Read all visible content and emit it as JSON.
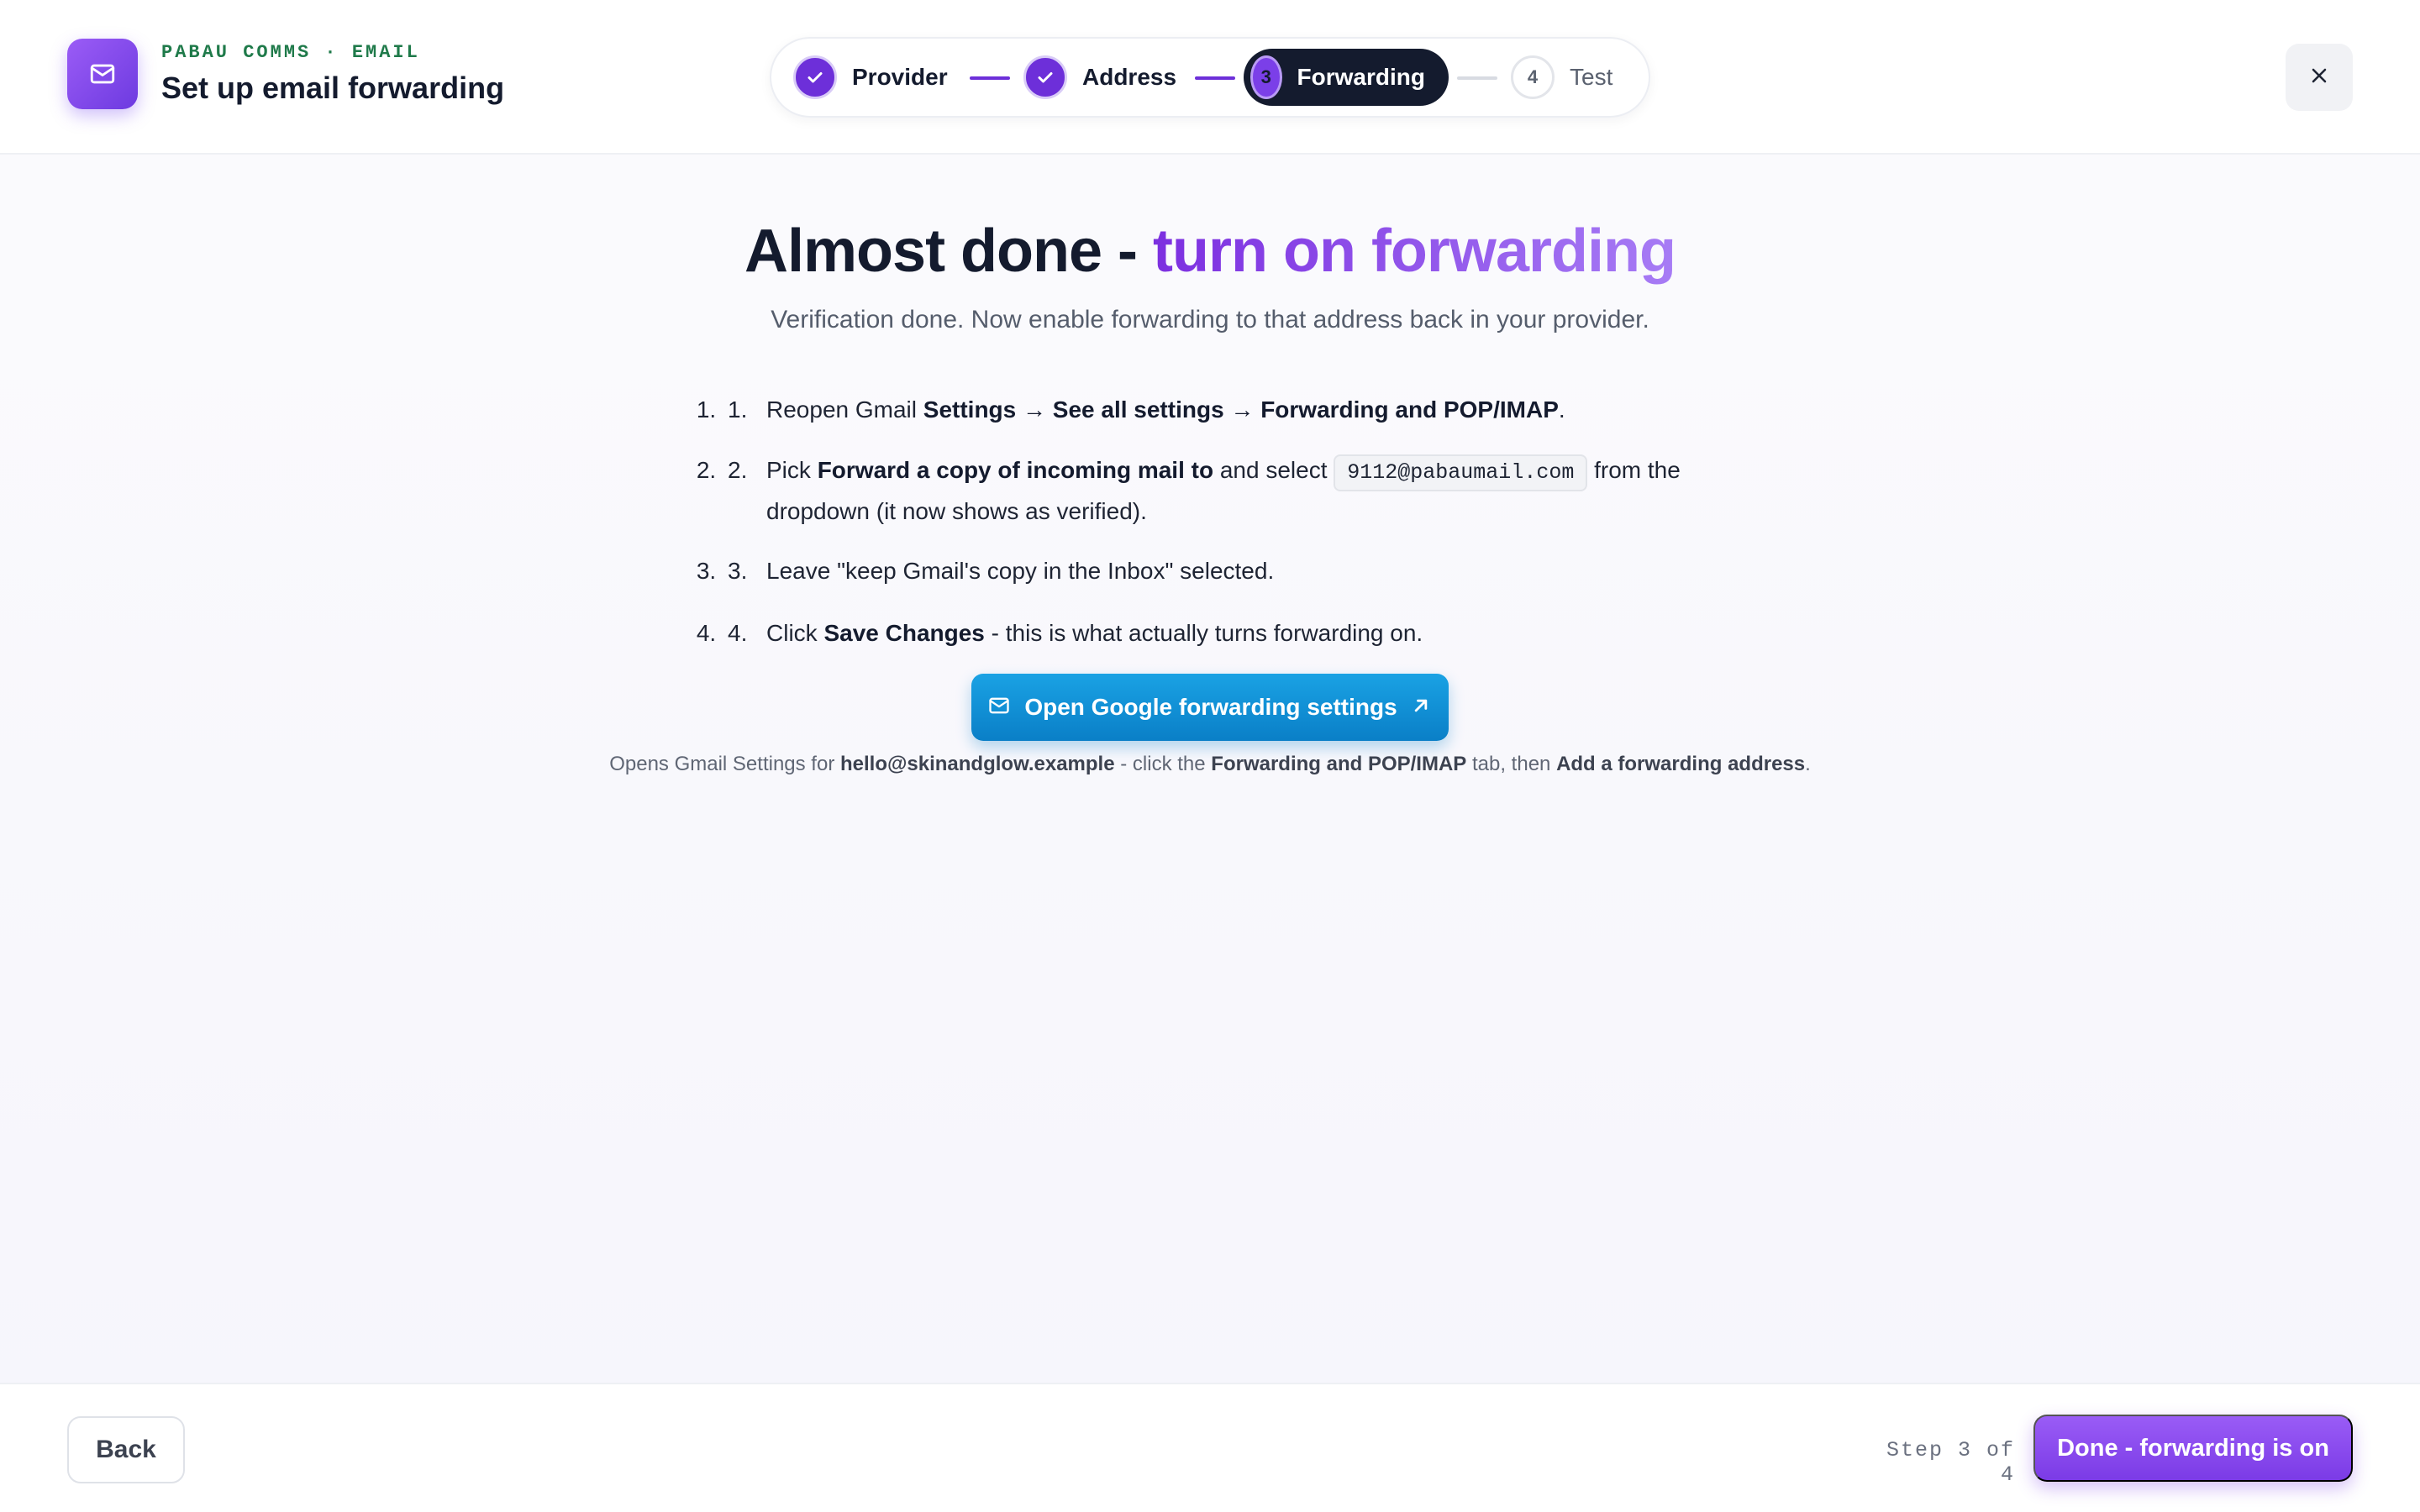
{
  "header": {
    "brand_icon": "mail-icon",
    "eyebrow": "PABAU COMMS · EMAIL",
    "title": "Set up email forwarding",
    "close_icon": "close-icon"
  },
  "stepper": {
    "steps": [
      {
        "number": "1",
        "label": "Provider",
        "status": "done"
      },
      {
        "number": "2",
        "label": "Address",
        "status": "done"
      },
      {
        "number": "3",
        "label": "Forwarding",
        "status": "active"
      },
      {
        "number": "4",
        "label": "Test",
        "status": "todo"
      }
    ]
  },
  "main": {
    "headline_lead": "Almost done - ",
    "headline_accent": "turn on forwarding",
    "subtitle": "Verification done. Now enable forwarding to that address back in your provider.",
    "instructions": {
      "item1": {
        "num": "1.",
        "t1": "Reopen Gmail ",
        "b1": "Settings → See all settings → Forwarding and POP/IMAP",
        "t2": "."
      },
      "item2": {
        "num": "2.",
        "t1": "Pick ",
        "b1": "Forward a copy of incoming mail to",
        "t2": " and select ",
        "code": "9112@pabaumail.com",
        "t3": " from the dropdown (it now shows as verified)."
      },
      "item3": {
        "num": "3.",
        "t1": "Leave \"keep Gmail's copy in the Inbox\" selected."
      },
      "item4": {
        "num": "4.",
        "t1": "Click ",
        "b1": "Save Changes",
        "t2": " - this is what actually turns forwarding on."
      }
    },
    "cta": {
      "label": "Open Google forwarding settings",
      "icon": "mail-icon",
      "trailing_icon": "external-link-icon"
    },
    "note": {
      "t1": "Opens Gmail Settings for ",
      "b1": "hello@skinandglow.example",
      "t2": " - click the ",
      "b2": "Forwarding and POP/IMAP",
      "t3": " tab, then ",
      "b3": "Add a forwarding address",
      "t4": "."
    }
  },
  "footer": {
    "back_label": "Back",
    "step_counter": "Step 3 of 4",
    "done_label": "Done - forwarding is on"
  },
  "colors": {
    "accent_purple": "#7b3be6",
    "cta_blue": "#0a7fc7",
    "eyebrow_green": "#1f7a4a",
    "ink": "#141b2e"
  }
}
